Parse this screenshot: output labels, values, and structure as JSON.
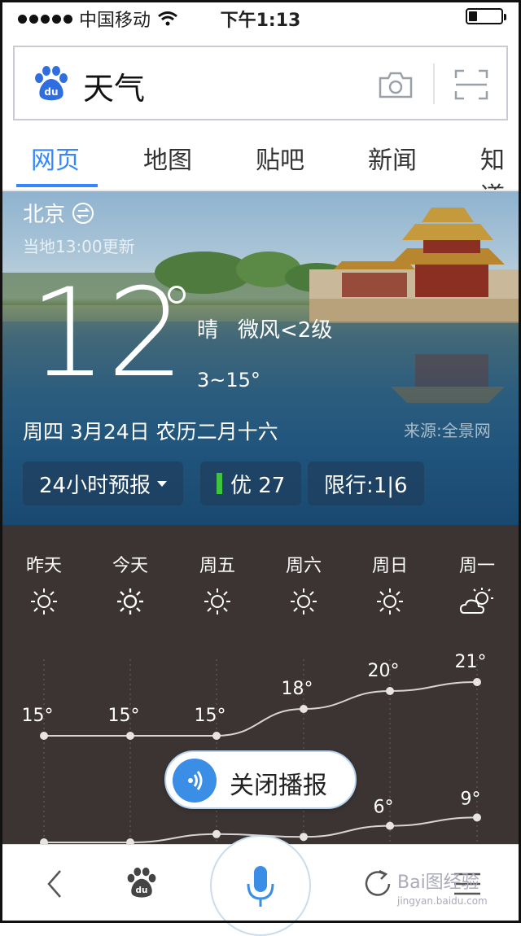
{
  "status_bar": {
    "carrier": "中国移动",
    "time": "下午1:13"
  },
  "search": {
    "query": "天气"
  },
  "tabs": [
    {
      "label": "网页",
      "active": true
    },
    {
      "label": "地图"
    },
    {
      "label": "贴吧"
    },
    {
      "label": "新闻"
    },
    {
      "label": "知道"
    }
  ],
  "weather": {
    "city": "北京",
    "updated": "当地13:00更新",
    "temperature": "12",
    "condition": "晴",
    "wind": "微风<2级",
    "range": "3~15°",
    "date": "周四 3月24日  农历二月十六",
    "source": "来源:全景网",
    "forecast_button": "24小时预报",
    "aqi_label": "优 27",
    "restriction": "限行:1|6"
  },
  "forecast": {
    "days": [
      "昨天",
      "今天",
      "周五",
      "周六",
      "周日",
      "周一"
    ],
    "icons": [
      "sun-icon",
      "sun-icon",
      "sun-icon",
      "sun-icon",
      "sun-icon",
      "partly-cloudy-icon"
    ]
  },
  "chart_data": {
    "type": "line",
    "categories": [
      "昨天",
      "今天",
      "周五",
      "周六",
      "周日",
      "周一"
    ],
    "series": [
      {
        "values": [
          15,
          15,
          15,
          18,
          20,
          21
        ],
        "labels": [
          "15°",
          "15°",
          "15°",
          "18°",
          "20°",
          "21°"
        ]
      },
      {
        "values": [
          0,
          0,
          3,
          2,
          6,
          9
        ],
        "labels": [
          "",
          "",
          "",
          "",
          "6°",
          "9°"
        ]
      }
    ]
  },
  "voice": {
    "label": "关闭播报"
  },
  "watermark": {
    "main": "Bai图经验",
    "sub": "jingyan.baidu.com"
  },
  "colors": {
    "accent": "#3388ff",
    "forecast_bg": "#3b3433",
    "aqi_good": "#3ec43e"
  }
}
